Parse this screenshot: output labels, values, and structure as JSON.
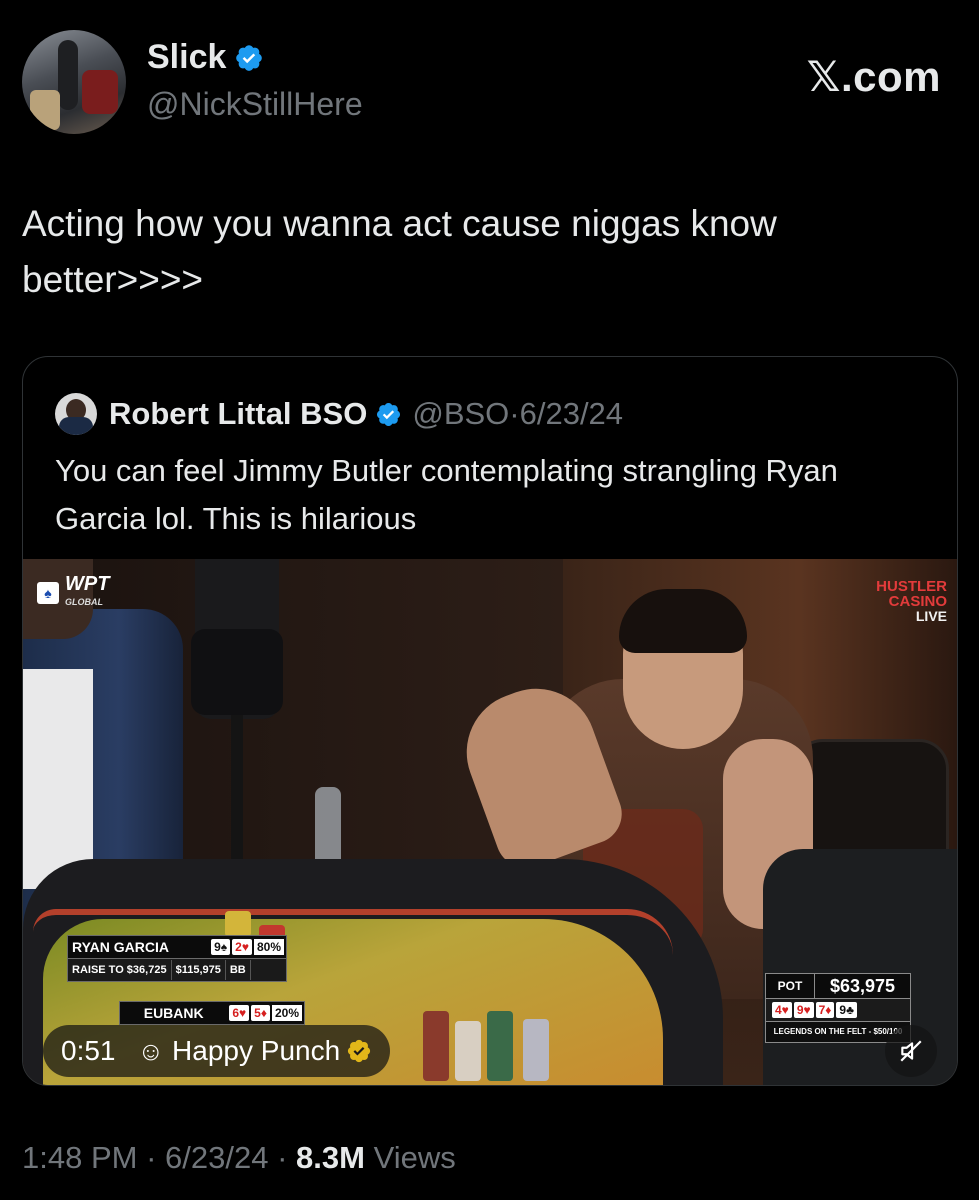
{
  "author": {
    "name": "Slick",
    "handle": "@NickStillHere",
    "verified_color": "#1d9bf0"
  },
  "brand": {
    "logo_text": "𝕏.com"
  },
  "tweet": {
    "text": "Acting how you wanna act cause niggas know better>>>>"
  },
  "quote": {
    "name": "Robert Littal BSO",
    "handle": "@BSO",
    "separator": "·",
    "date": "6/23/24",
    "text": "You can feel Jimmy Butler contemplating strangling Ryan Garcia lol. This is hilarious"
  },
  "video": {
    "wpt_logo": "WPT",
    "wpt_sub": "GLOBAL",
    "hustler_line1": "HUSTLER",
    "hustler_line2": "CASINO",
    "hustler_line3": "LIVE",
    "player1": {
      "name": "RYAN GARCIA",
      "card1": "9♠",
      "card2": "2♥",
      "equity": "80%",
      "action": "RAISE TO $36,725",
      "stack": "$115,975",
      "position": "BB"
    },
    "player2": {
      "name": "EUBANK",
      "card1": "6♥",
      "card2": "5♦",
      "equity": "20%"
    },
    "pot_label": "POT",
    "pot_value": "$63,975",
    "board": [
      "4♥",
      "9♥",
      "7♦",
      "9♣"
    ],
    "ticker": "LEGENDS ON THE FELT - $50/100",
    "elapsed": "0:51",
    "song": "Happy Punch",
    "mute_icon": "speaker-muted-icon"
  },
  "meta": {
    "time": "1:48 PM",
    "separator": "·",
    "date": "6/23/24",
    "views_count": "8.3M",
    "views_label": "Views"
  }
}
